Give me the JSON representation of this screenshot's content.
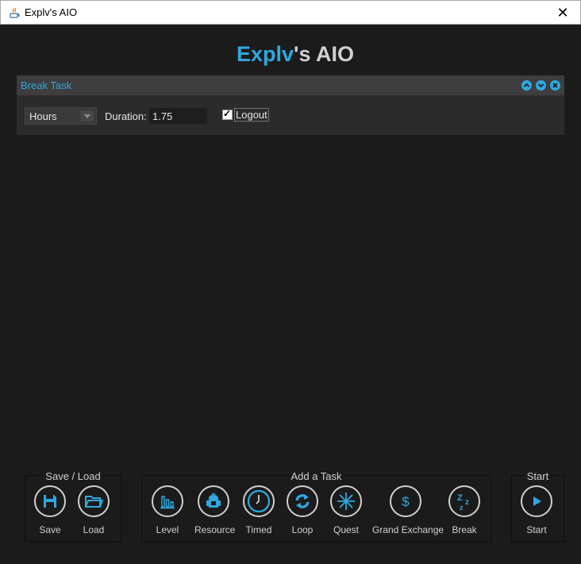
{
  "window": {
    "title": "Explv's AIO",
    "close_icon": "close-icon",
    "app_icon": "java-icon"
  },
  "heading": {
    "accent": "Explv",
    "rest": "'s AIO"
  },
  "task_panel": {
    "title": "Break Task",
    "unit_select": {
      "value": "Hours"
    },
    "duration_label": "Duration:",
    "duration_value": "1.75",
    "logout_label": "Logout",
    "logout_checked": true,
    "header_buttons": [
      "move-up-icon",
      "move-down-icon",
      "remove-icon"
    ]
  },
  "save_load": {
    "title": "Save / Load",
    "buttons": [
      {
        "label": "Save",
        "icon": "floppy-disk-icon"
      },
      {
        "label": "Load",
        "icon": "folder-icon"
      }
    ]
  },
  "add_task": {
    "title": "Add a Task",
    "buttons": [
      {
        "label": "Level",
        "icon": "bar-chart-icon"
      },
      {
        "label": "Resource",
        "icon": "backpack-icon"
      },
      {
        "label": "Timed",
        "icon": "clock-icon"
      },
      {
        "label": "Loop",
        "icon": "loop-icon"
      },
      {
        "label": "Quest",
        "icon": "asterisk-icon"
      },
      {
        "label": "Grand Exchange",
        "icon": "dollar-icon"
      },
      {
        "label": "Break",
        "icon": "sleep-icon"
      }
    ]
  },
  "start": {
    "title": "Start",
    "button": {
      "label": "Start",
      "icon": "play-icon"
    }
  },
  "colors": {
    "accent": "#2fa8e0",
    "background": "#1b1b1b",
    "panel": "#2b2b2b",
    "panel_header": "#3e3e3e",
    "text": "#d0d0d0"
  }
}
